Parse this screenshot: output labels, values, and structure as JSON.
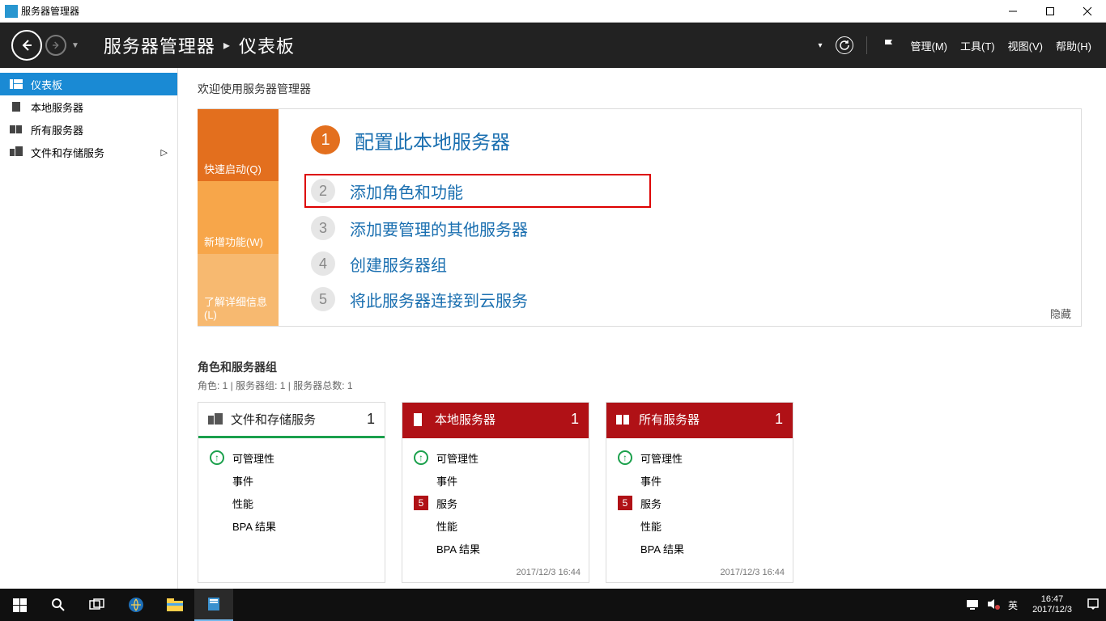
{
  "window": {
    "title": "服务器管理器"
  },
  "breadcrumb": {
    "root": "服务器管理器",
    "page": "仪表板"
  },
  "header_menus": {
    "manage": "管理(M)",
    "tools": "工具(T)",
    "view": "视图(V)",
    "help": "帮助(H)"
  },
  "sidebar": {
    "items": [
      {
        "label": "仪表板",
        "icon": "dashboard",
        "active": true
      },
      {
        "label": "本地服务器",
        "icon": "server",
        "active": false
      },
      {
        "label": "所有服务器",
        "icon": "servers",
        "active": false
      },
      {
        "label": "文件和存储服务",
        "icon": "storage",
        "active": false,
        "expandable": true
      }
    ]
  },
  "welcome": {
    "label": "欢迎使用服务器管理器"
  },
  "quickstart": {
    "tabs": [
      {
        "label": "快速启动(Q)"
      },
      {
        "label": "新增功能(W)"
      },
      {
        "label": "了解详细信息(L)"
      }
    ],
    "steps": [
      {
        "n": "1",
        "label": "配置此本地服务器"
      },
      {
        "n": "2",
        "label": "添加角色和功能"
      },
      {
        "n": "3",
        "label": "添加要管理的其他服务器"
      },
      {
        "n": "4",
        "label": "创建服务器组"
      },
      {
        "n": "5",
        "label": "将此服务器连接到云服务"
      }
    ],
    "hide": "隐藏"
  },
  "roles": {
    "title": "角色和服务器组",
    "subtitle": "角色: 1 | 服务器组: 1 | 服务器总数: 1",
    "tiles": [
      {
        "title": "文件和存储服务",
        "count": "1",
        "style": "green",
        "rows": [
          {
            "ind": "up",
            "label": "可管理性"
          },
          {
            "ind": "",
            "label": "事件"
          },
          {
            "ind": "",
            "label": "性能"
          },
          {
            "ind": "",
            "label": "BPA 结果"
          }
        ],
        "timestamp": ""
      },
      {
        "title": "本地服务器",
        "count": "1",
        "style": "red",
        "rows": [
          {
            "ind": "up",
            "label": "可管理性"
          },
          {
            "ind": "",
            "label": "事件"
          },
          {
            "ind": "5",
            "label": "服务"
          },
          {
            "ind": "",
            "label": "性能"
          },
          {
            "ind": "",
            "label": "BPA 结果"
          }
        ],
        "timestamp": "2017/12/3 16:44"
      },
      {
        "title": "所有服务器",
        "count": "1",
        "style": "red",
        "rows": [
          {
            "ind": "up",
            "label": "可管理性"
          },
          {
            "ind": "",
            "label": "事件"
          },
          {
            "ind": "5",
            "label": "服务"
          },
          {
            "ind": "",
            "label": "性能"
          },
          {
            "ind": "",
            "label": "BPA 结果"
          }
        ],
        "timestamp": "2017/12/3 16:44"
      }
    ]
  },
  "taskbar": {
    "ime": "英",
    "time": "16:47",
    "date": "2017/12/3"
  }
}
